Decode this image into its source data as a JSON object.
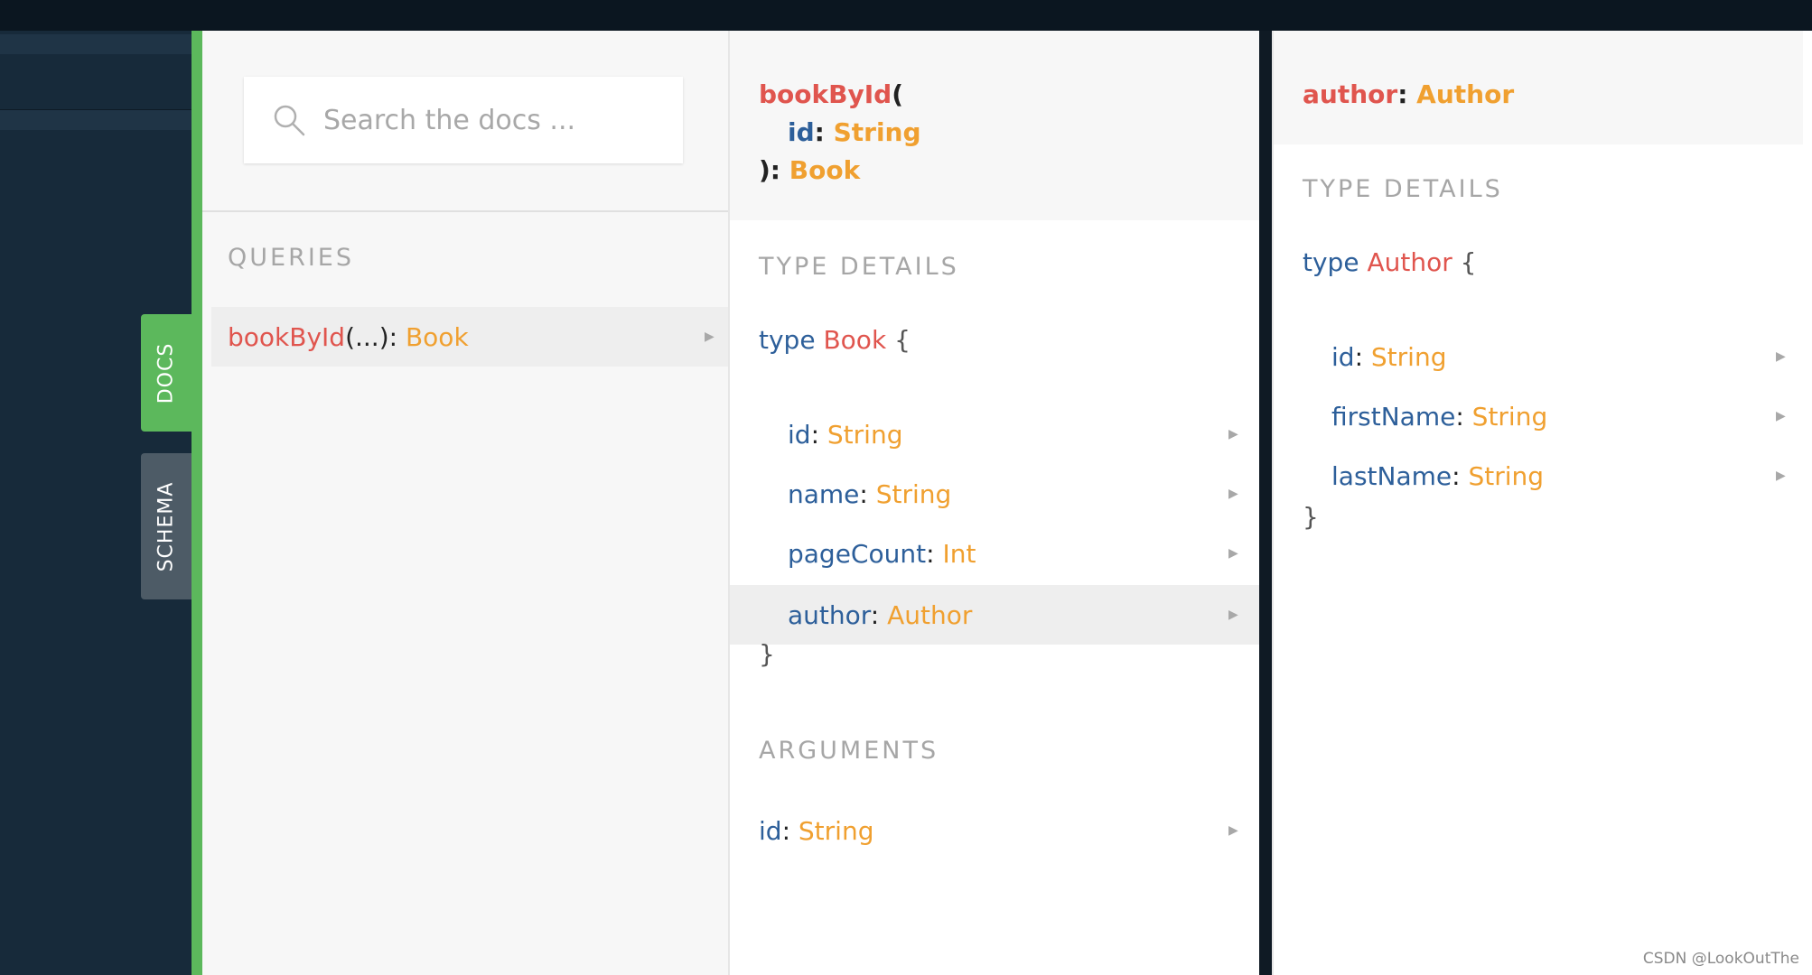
{
  "search": {
    "placeholder": "Search the docs ..."
  },
  "side_tabs": {
    "docs": "DOCS",
    "schema": "SCHEMA"
  },
  "queries_panel": {
    "section_title": "QUERIES",
    "items": [
      {
        "name": "bookById",
        "args": "(...)",
        "sep": ": ",
        "type": "Book"
      }
    ]
  },
  "book_panel": {
    "header": {
      "name": "bookById",
      "open": "(",
      "arg_name": "id",
      "arg_sep": ": ",
      "arg_type": "String",
      "close": "): ",
      "return_type": "Book"
    },
    "type_details_title": "TYPE DETAILS",
    "type_keyword": "type",
    "type_name": "Book",
    "open_brace": "{",
    "close_brace": "}",
    "fields": [
      {
        "name": "id",
        "sep": ": ",
        "type": "String"
      },
      {
        "name": "name",
        "sep": ": ",
        "type": "String"
      },
      {
        "name": "pageCount",
        "sep": ": ",
        "type": "Int"
      },
      {
        "name": "author",
        "sep": ": ",
        "type": "Author"
      }
    ],
    "arguments_title": "ARGUMENTS",
    "arguments": [
      {
        "name": "id",
        "sep": ": ",
        "type": "String"
      }
    ]
  },
  "author_panel": {
    "header": {
      "name": "author",
      "sep": ": ",
      "type": "Author"
    },
    "type_details_title": "TYPE DETAILS",
    "type_keyword": "type",
    "type_name": "Author",
    "open_brace": "{",
    "close_brace": "}",
    "fields": [
      {
        "name": "id",
        "sep": ": ",
        "type": "String"
      },
      {
        "name": "firstName",
        "sep": ": ",
        "type": "String"
      },
      {
        "name": "lastName",
        "sep": ": ",
        "type": "String"
      }
    ]
  },
  "arrow_glyph": "▶",
  "watermark": "CSDN @LookOutThe",
  "colors": {
    "accent_green": "#5cb85c",
    "function_name": "#e0554e",
    "type_name": "#f0a030",
    "field_name": "#2d5f9a"
  }
}
